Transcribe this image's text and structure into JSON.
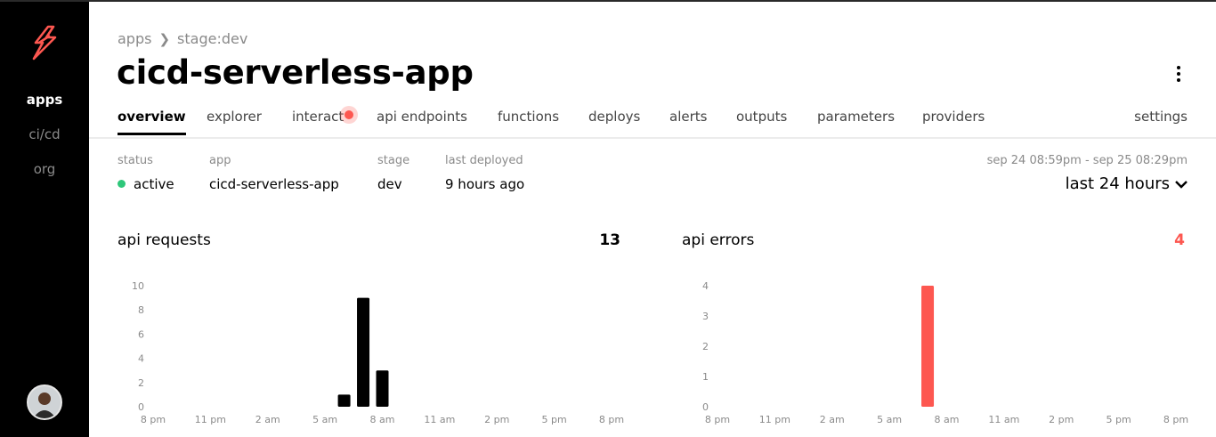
{
  "sidebar": {
    "items": [
      {
        "label": "apps",
        "active": true
      },
      {
        "label": "ci/cd",
        "active": false
      },
      {
        "label": "org",
        "active": false
      }
    ],
    "logo_color": "#fd5750"
  },
  "header": {
    "breadcrumb": [
      "apps",
      "stage:dev"
    ],
    "title": "cicd-serverless-app",
    "more_icon": "kebab-menu-icon"
  },
  "tabs": [
    "overview",
    "explorer",
    "interact",
    "api endpoints",
    "functions",
    "deploys",
    "alerts",
    "outputs",
    "parameters",
    "providers",
    "settings"
  ],
  "active_tab": "overview",
  "meta": {
    "status": {
      "label": "status",
      "value": "active",
      "color": "#2fc77a"
    },
    "app": {
      "label": "app",
      "value": "cicd-serverless-app"
    },
    "stage": {
      "label": "stage",
      "value": "dev"
    },
    "last_deployed": {
      "label": "last deployed",
      "value": "9 hours ago"
    }
  },
  "time_range": {
    "span": "sep 24 08:59pm - sep 25 08:29pm",
    "selected": "last 24 hours"
  },
  "chart_data": [
    {
      "type": "bar",
      "title": "api requests",
      "total": "13",
      "total_color": "#000000",
      "bar_color": "#000000",
      "x_ticks": [
        "8 pm",
        "11 pm",
        "2 am",
        "5 am",
        "8 am",
        "11 am",
        "2 pm",
        "5 pm",
        "8 pm"
      ],
      "y_ticks": [
        "0",
        "2",
        "4",
        "6",
        "8",
        "10"
      ],
      "ylim": [
        0,
        10
      ],
      "bars": [
        {
          "x_hour": 10,
          "value": 1
        },
        {
          "x_hour": 11,
          "value": 9
        },
        {
          "x_hour": 12,
          "value": 3
        }
      ]
    },
    {
      "type": "bar",
      "title": "api errors",
      "total": "4",
      "total_color": "#fd5750",
      "bar_color": "#fd5750",
      "x_ticks": [
        "8 pm",
        "11 pm",
        "2 am",
        "5 am",
        "8 am",
        "11 am",
        "2 pm",
        "5 pm",
        "8 pm"
      ],
      "y_ticks": [
        "0",
        "1",
        "2",
        "3",
        "4"
      ],
      "ylim": [
        0,
        4
      ],
      "bars": [
        {
          "x_hour": 11,
          "value": 4
        }
      ]
    }
  ]
}
